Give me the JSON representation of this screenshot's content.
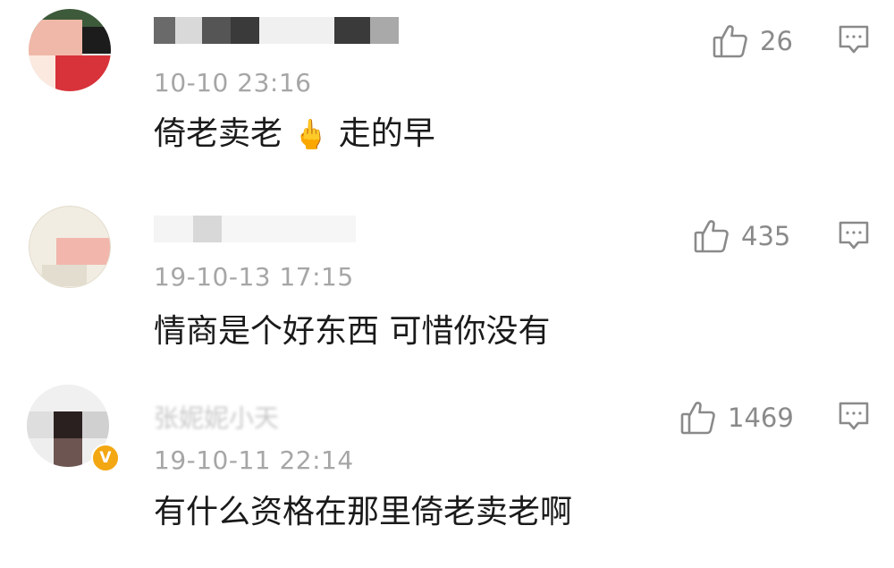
{
  "comments": [
    {
      "username": "",
      "timestamp": "10-10 23:16",
      "text_before_emoji": "倚老卖老",
      "emoji": "🖕",
      "text_after_emoji": "走的早",
      "likes": "26",
      "verified": false
    },
    {
      "username": "",
      "timestamp": "19-10-13 17:15",
      "text": "情商是个好东西 可惜你没有",
      "likes": "435",
      "verified": false
    },
    {
      "username": "",
      "username_visible_fragment": "张妮妮小天",
      "timestamp": "19-10-11 22:14",
      "text": "有什么资格在那里倚老卖老啊",
      "likes": "1469",
      "verified": true,
      "badge": "V"
    }
  ],
  "icons": {
    "like": "thumbs-up-icon",
    "reply": "comment-bubble-icon"
  },
  "colors": {
    "text_primary": "#1a1a1a",
    "text_meta": "#a6a6a6",
    "icon_gray": "#8a8a8a",
    "verified_badge": "#f3a712"
  }
}
